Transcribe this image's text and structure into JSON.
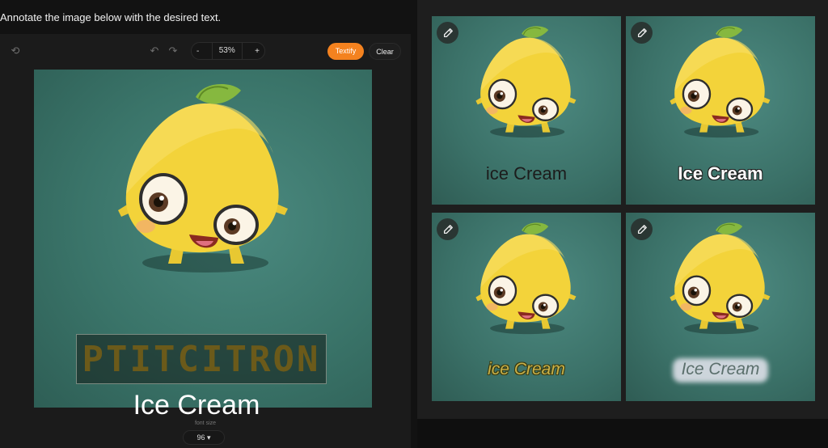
{
  "instruction": "Annotate the image below with the desired text.",
  "toolbar": {
    "zoom_minus": "-",
    "zoom_value": "53%",
    "zoom_plus": "+",
    "textify_label": "Textify",
    "clear_label": "Clear"
  },
  "canvas": {
    "annotation_text": "PTITCITRON",
    "caption_text": "Ice Cream"
  },
  "font_size": {
    "label": "font size",
    "value": "96 ▾"
  },
  "results": [
    {
      "text": "ice Cream"
    },
    {
      "text": "Ice Cream"
    },
    {
      "text": "ice Cream"
    },
    {
      "text": "Ice Cream"
    }
  ],
  "colors": {
    "accent": "#f4821f",
    "background": "#121212",
    "tile_bg": "#3b7168"
  },
  "icons": [
    "reset-icon",
    "undo-icon",
    "redo-icon",
    "pencil-icon"
  ]
}
